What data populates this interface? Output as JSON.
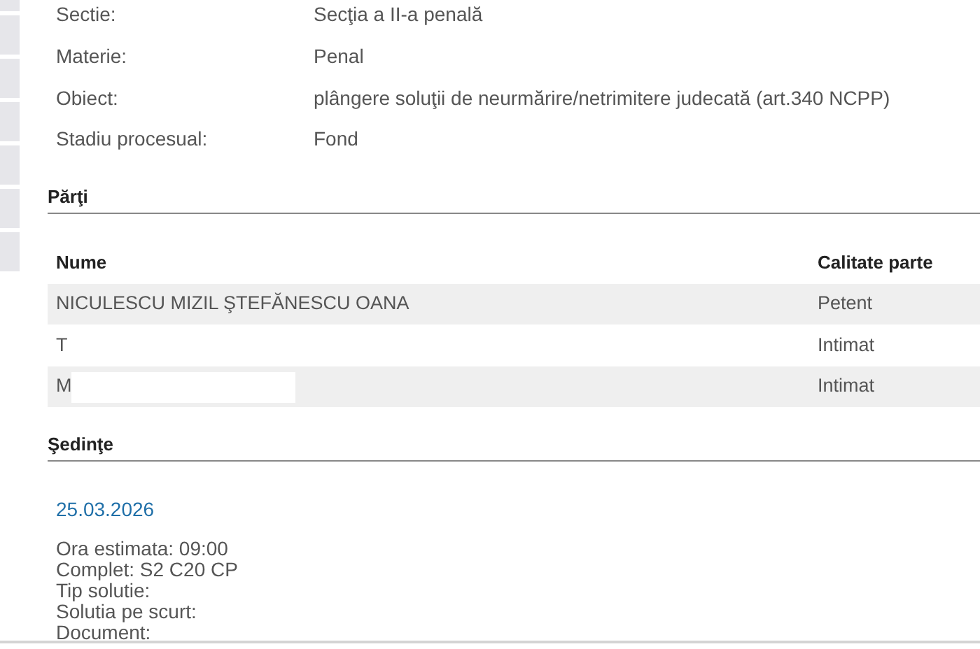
{
  "details": [
    {
      "label": "Sectie:",
      "value": "Secţia a II-a penală"
    },
    {
      "label": "Materie:",
      "value": "Penal"
    },
    {
      "label": "Obiect:",
      "value": "plângere soluţii de neurmărire/netrimitere judecată (art.340 NCPP)"
    },
    {
      "label": "Stadiu procesual:",
      "value": "Fond"
    }
  ],
  "parti": {
    "title": "Părţi",
    "columns": [
      "Nume",
      "Calitate parte"
    ],
    "rows": [
      {
        "name": "NICULESCU MIZIL ŞTEFĂNESCU OANA",
        "role": "Petent"
      },
      {
        "name": "T",
        "role": "Intimat"
      },
      {
        "name": "M",
        "role": "Intimat",
        "redacted": true
      }
    ]
  },
  "sedinte": {
    "title": "Şedinţe",
    "date": "25.03.2026",
    "lines": [
      "Ora estimata: 09:00",
      "Complet: S2 C20 CP",
      "Tip solutie:",
      "Solutia pe scurt:",
      "Document:"
    ]
  }
}
